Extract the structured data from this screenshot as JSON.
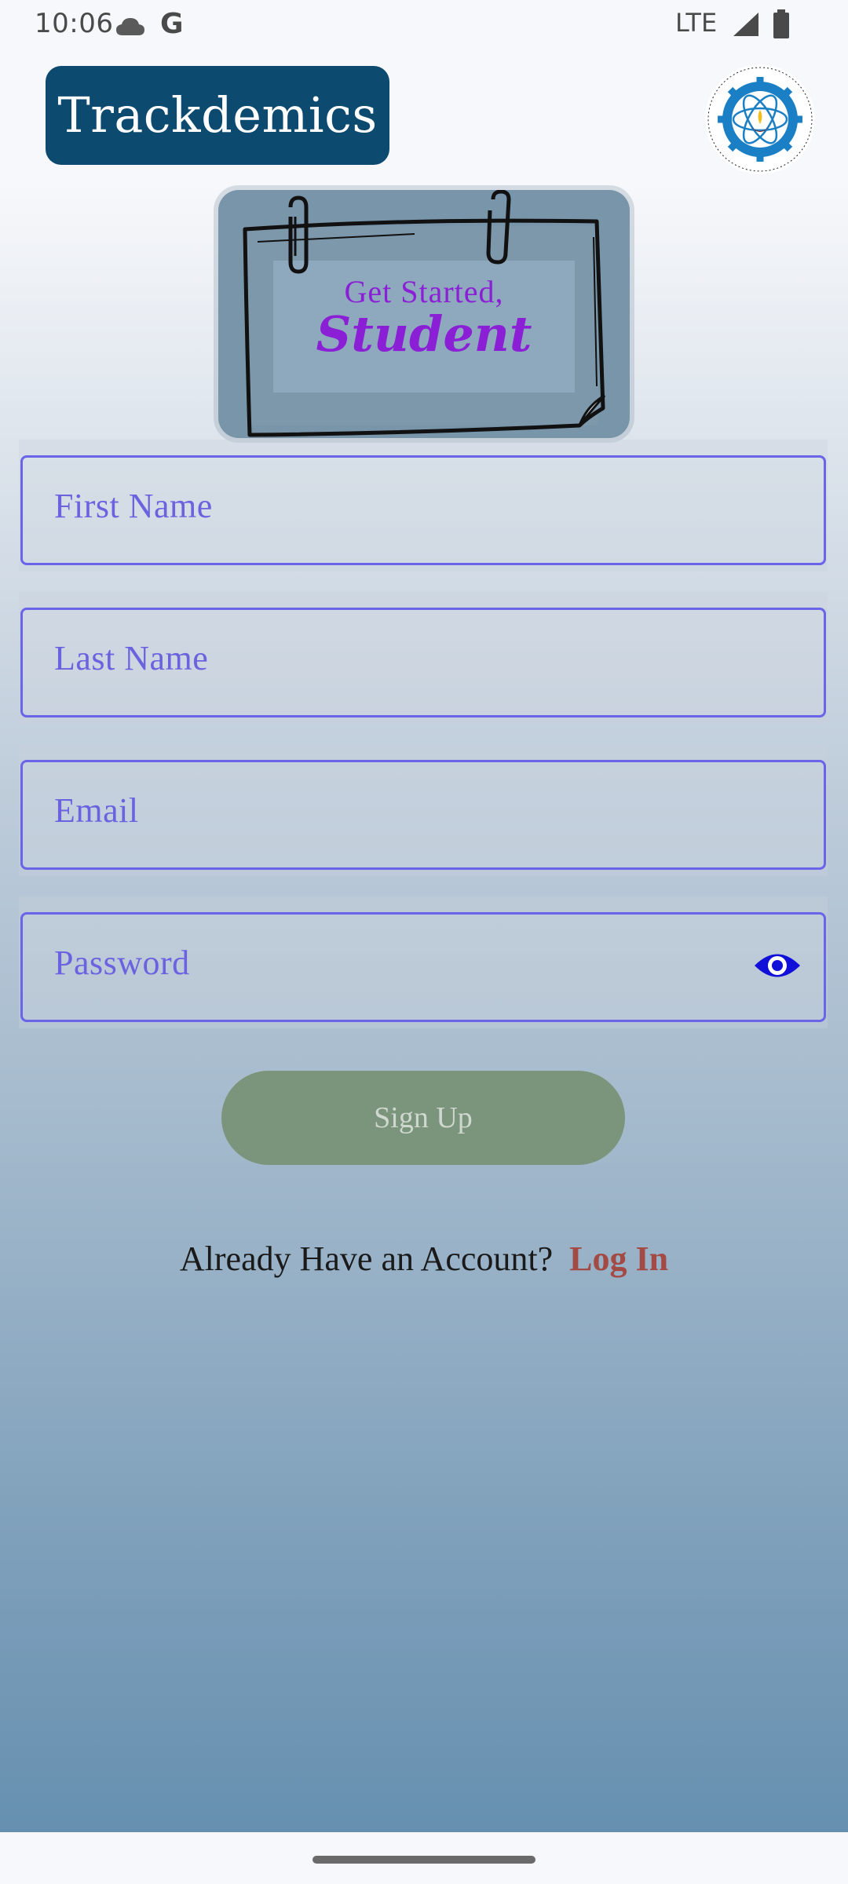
{
  "status_bar": {
    "time": "10:06",
    "network": "LTE",
    "icons": [
      "cloud-icon",
      "google-icon",
      "signal-icon",
      "battery-icon"
    ]
  },
  "header": {
    "app_title": "Trackdemics",
    "logo_icon": "institute-logo-icon"
  },
  "hero": {
    "line1": "Get Started,",
    "line2": "Student"
  },
  "form": {
    "first_name": {
      "placeholder": "First Name",
      "value": ""
    },
    "last_name": {
      "placeholder": "Last Name",
      "value": ""
    },
    "email": {
      "placeholder": "Email",
      "value": ""
    },
    "password": {
      "placeholder": "Password",
      "value": "",
      "toggle_icon": "eye-icon"
    }
  },
  "actions": {
    "signup_label": "Sign Up",
    "login_prompt": "Already Have an Account?",
    "login_link": "Log In"
  },
  "colors": {
    "brand_bg": "#0d4a70",
    "accent_purple": "#8a1fd6",
    "field_border": "#6a64e8",
    "signup_bg": "#7a957b",
    "login_link": "#a34a45"
  }
}
